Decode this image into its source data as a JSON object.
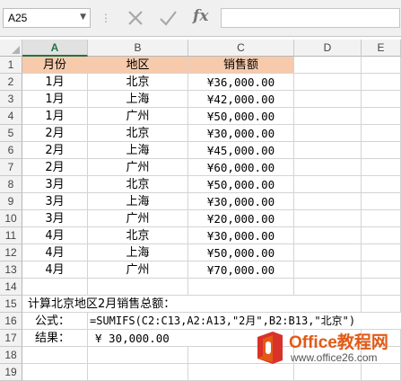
{
  "name_box": {
    "value": "A25"
  },
  "formula_bar": {
    "separator": "⋮",
    "fx_label": "fx",
    "value": ""
  },
  "columns": [
    "A",
    "B",
    "C",
    "D",
    "E"
  ],
  "rows": [
    {
      "num": "1",
      "a": "月份",
      "b": "地区",
      "c": "销售额"
    },
    {
      "num": "2",
      "a": "1月",
      "b": "北京",
      "c": "¥36,000.00"
    },
    {
      "num": "3",
      "a": "1月",
      "b": "上海",
      "c": "¥42,000.00"
    },
    {
      "num": "4",
      "a": "1月",
      "b": "广州",
      "c": "¥50,000.00"
    },
    {
      "num": "5",
      "a": "2月",
      "b": "北京",
      "c": "¥30,000.00"
    },
    {
      "num": "6",
      "a": "2月",
      "b": "上海",
      "c": "¥45,000.00"
    },
    {
      "num": "7",
      "a": "2月",
      "b": "广州",
      "c": "¥60,000.00"
    },
    {
      "num": "8",
      "a": "3月",
      "b": "北京",
      "c": "¥50,000.00"
    },
    {
      "num": "9",
      "a": "3月",
      "b": "上海",
      "c": "¥30,000.00"
    },
    {
      "num": "10",
      "a": "3月",
      "b": "广州",
      "c": "¥20,000.00"
    },
    {
      "num": "11",
      "a": "4月",
      "b": "北京",
      "c": "¥30,000.00"
    },
    {
      "num": "12",
      "a": "4月",
      "b": "上海",
      "c": "¥50,000.00"
    },
    {
      "num": "13",
      "a": "4月",
      "b": "广州",
      "c": "¥70,000.00"
    },
    {
      "num": "14",
      "a": "",
      "b": "",
      "c": ""
    },
    {
      "num": "15",
      "text": "计算北京地区2月销售总额："
    },
    {
      "num": "16",
      "a": "公式：",
      "text": "=SUMIFS(C2:C13,A2:A13,\"2月\",B2:B13,\"北京\")"
    },
    {
      "num": "17",
      "a": "结果：",
      "text": "¥  30,000.00"
    },
    {
      "num": "18"
    },
    {
      "num": "19"
    }
  ],
  "watermark": {
    "brand": "Office教程网",
    "url": "www.office26.com",
    "colors": {
      "orange": "#e35a15",
      "red": "#d9322a"
    }
  }
}
